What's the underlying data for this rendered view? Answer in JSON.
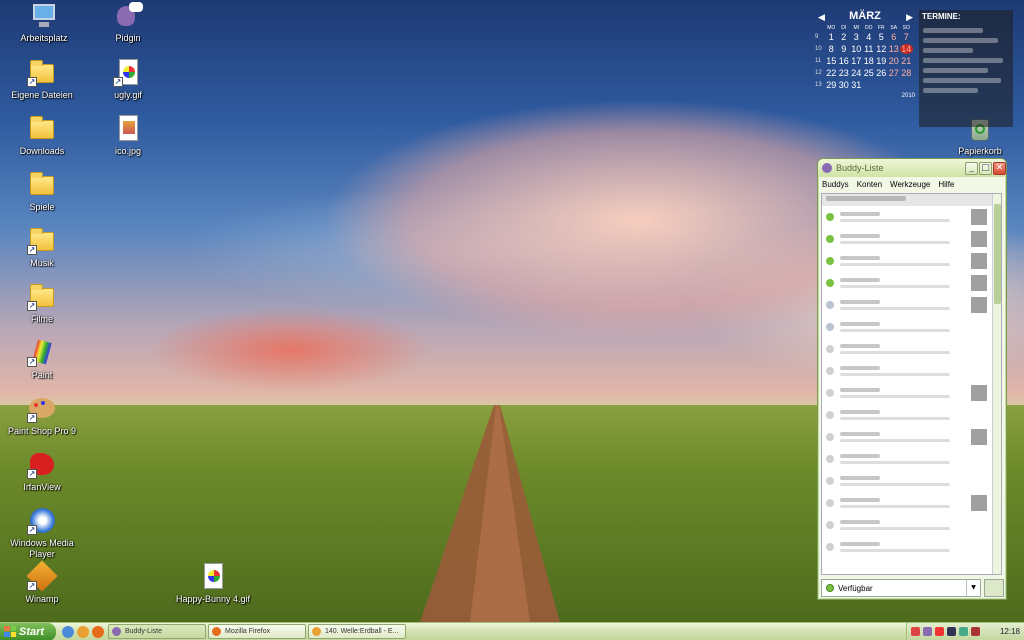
{
  "desktop": {
    "icons": [
      {
        "label": "Arbeitsplatz",
        "icon": "computer-icon"
      },
      {
        "label": "Pidgin",
        "icon": "pidgin-icon"
      },
      {
        "label": "Eigene Dateien",
        "icon": "folder-icon"
      },
      {
        "label": "ugly.gif",
        "icon": "image-file-icon"
      },
      {
        "label": "Downloads",
        "icon": "folder-icon"
      },
      {
        "label": "ico.jpg",
        "icon": "image-file-icon"
      },
      {
        "label": "Spiele",
        "icon": "folder-icon"
      },
      {
        "label": "Musik",
        "icon": "folder-icon"
      },
      {
        "label": "Filme",
        "icon": "folder-icon"
      },
      {
        "label": "Paint",
        "icon": "paint-icon"
      },
      {
        "label": "Paint Shop Pro 9",
        "icon": "palette-icon"
      },
      {
        "label": "IrfanView",
        "icon": "irfanview-icon"
      },
      {
        "label": "Windows Media Player",
        "icon": "media-player-icon"
      },
      {
        "label": "Winamp",
        "icon": "winamp-icon"
      },
      {
        "label": "Happy-Bunny 4.gif",
        "icon": "image-file-icon"
      },
      {
        "label": "Papierkorb",
        "icon": "recycle-bin-icon"
      }
    ]
  },
  "calendar": {
    "month": "MÄRZ",
    "year": "2010",
    "dow": [
      "MO",
      "DI",
      "MI",
      "DO",
      "FR",
      "SA",
      "SO"
    ],
    "weeks": [
      {
        "wk": "9",
        "days": [
          "1",
          "2",
          "3",
          "4",
          "5",
          "6",
          "7"
        ]
      },
      {
        "wk": "10",
        "days": [
          "8",
          "9",
          "10",
          "11",
          "12",
          "13",
          "14"
        ]
      },
      {
        "wk": "11",
        "days": [
          "15",
          "16",
          "17",
          "18",
          "19",
          "20",
          "21"
        ]
      },
      {
        "wk": "12",
        "days": [
          "22",
          "23",
          "24",
          "25",
          "26",
          "27",
          "28"
        ]
      },
      {
        "wk": "13",
        "days": [
          "29",
          "30",
          "31",
          "",
          "",
          "",
          ""
        ]
      }
    ],
    "today": "14"
  },
  "termine": {
    "title": "TERMINE:"
  },
  "buddy_window": {
    "title": "Buddy-Liste",
    "menu": [
      "Buddys",
      "Konten",
      "Werkzeuge",
      "Hilfe"
    ],
    "status": "Verfügbar"
  },
  "taskbar": {
    "start_label": "Start",
    "tasks": [
      "Buddy-Liste",
      "Mozilla Firefox",
      "140. Welle:Erdball - E..."
    ],
    "clock": "12:18"
  },
  "colors": {
    "online": "#7ac142",
    "away": "#b9c4d0",
    "offline": "#d0d0d0"
  }
}
